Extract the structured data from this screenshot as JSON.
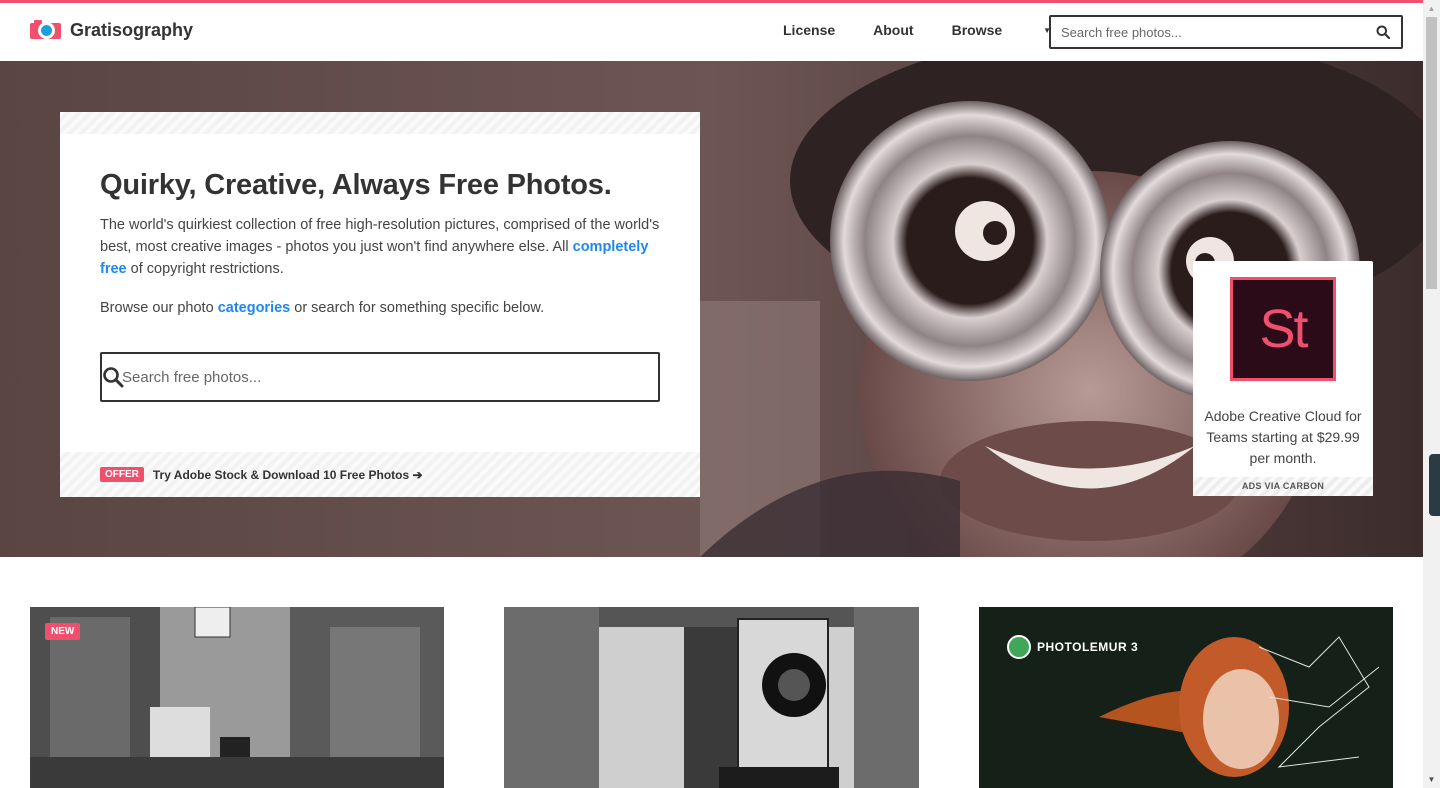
{
  "brand": {
    "name": "Gratisography",
    "accent": "#f0506e",
    "link_color": "#1e87f0"
  },
  "nav": {
    "items": [
      {
        "label": "License"
      },
      {
        "label": "About"
      },
      {
        "label": "Browse"
      }
    ]
  },
  "header_search": {
    "placeholder": "Search free photos..."
  },
  "hero": {
    "title": "Quirky, Creative, Always Free Photos.",
    "desc_part1": "The world's quirkiest collection of free high-resolution pictures, comprised of the world's best, most creative images - photos you just won't find anywhere else. All ",
    "desc_link": "completely free",
    "desc_part2": " of copyright restrictions.",
    "browse_part1": "Browse our photo ",
    "browse_link": "categories",
    "browse_part2": " or search for something specific below.",
    "search_placeholder": "Search free photos...",
    "offer_badge": "OFFER",
    "offer_text": "Try Adobe Stock & Download 10 Free Photos"
  },
  "ad": {
    "logo_text": "St",
    "text": "Adobe Creative Cloud for Teams starting at $29.99 per month.",
    "via": "ADS VIA CARBON"
  },
  "tiles": [
    {
      "badge": "NEW",
      "icon": "city-street-photo"
    },
    {
      "icon": "camera-photo"
    },
    {
      "brand": "PHOTOLEMUR 3",
      "icon": "photolemur-ad-photo"
    }
  ],
  "icons": {
    "search": "search-icon",
    "caret": "caret-down-icon",
    "arrow": "arrow-right-icon"
  }
}
